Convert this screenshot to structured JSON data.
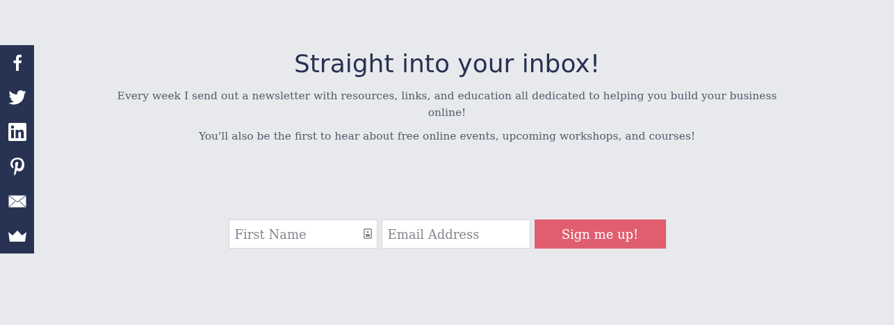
{
  "heading": "Straight into your inbox!",
  "paragraphs": [
    "Every week I send out a newsletter with resources, links, and education all dedicated to helping you build your business online!",
    "You'll also be the first to hear about free online events, upcoming workshops, and courses!"
  ],
  "form": {
    "first_name": {
      "placeholder": "First Name"
    },
    "email": {
      "placeholder": "Email Address"
    },
    "submit": "Sign me up!"
  }
}
